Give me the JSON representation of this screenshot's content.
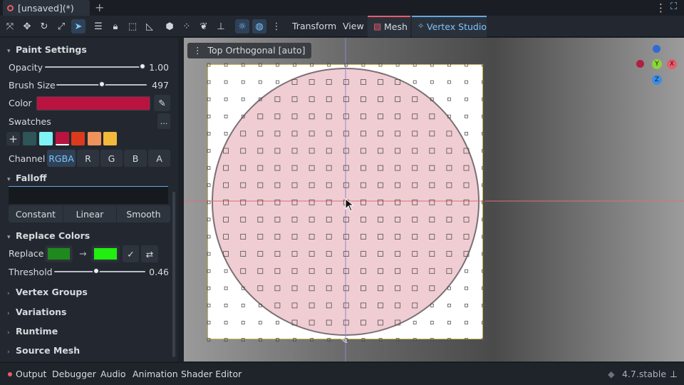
{
  "tabs": {
    "doc_title": "[unsaved](*)",
    "add_label": "+"
  },
  "toolbar": {
    "menu_transform": "Transform",
    "menu_view": "View",
    "menu_mesh": "Mesh",
    "menu_vertex_studio": "Vertex Studio",
    "icons": [
      "move-icon",
      "move-alt-icon",
      "rotate-icon",
      "scale-icon",
      "select-icon",
      "list-icon",
      "lock-icon",
      "group-icon",
      "ruler-icon",
      "snap-icon",
      "cube-icon",
      "nodes-icon",
      "leaf-icon",
      "pin-icon",
      "sun-icon",
      "globe-icon",
      "kebab-icon"
    ]
  },
  "paint_settings": {
    "title": "Paint Settings",
    "opacity_label": "Opacity",
    "opacity_value": "1.00",
    "opacity_fraction": 1.0,
    "brush_size_label": "Brush Size",
    "brush_size_value": "497",
    "brush_size_fraction": 0.5,
    "color_label": "Color",
    "color_hex": "#b8143f",
    "swatches_label": "Swatches",
    "swatches_more": "...",
    "swatch_add": "+",
    "swatches": [
      "#2e5557",
      "#7ff3f6",
      "#b8143f",
      "#dc3a1c",
      "#f0925c",
      "#f2b93a"
    ],
    "channel_label": "Channel",
    "channels": [
      "RGBA",
      "R",
      "G",
      "B",
      "A"
    ],
    "channel_selected": "RGBA"
  },
  "falloff": {
    "title": "Falloff",
    "modes": [
      "Constant",
      "Linear",
      "Smooth"
    ]
  },
  "replace_colors": {
    "title": "Replace Colors",
    "replace_label": "Replace",
    "from_color": "#1e8a1e",
    "to_color": "#22ee11",
    "arrow": "→",
    "threshold_label": "Threshold",
    "threshold_value": "0.46",
    "threshold_fraction": 0.46
  },
  "collapsed_sections": [
    "Vertex Groups",
    "Variations",
    "Runtime",
    "Source Mesh"
  ],
  "viewport": {
    "label": "Top Orthogonal [auto]",
    "gizmo": {
      "y": "Y",
      "x": "X",
      "z": "Z"
    }
  },
  "bottom": {
    "output": "Output",
    "debugger": "Debugger",
    "audio": "Audio",
    "animation": "Animation",
    "shader_editor": "Shader Editor",
    "version": "4.7.stable"
  }
}
